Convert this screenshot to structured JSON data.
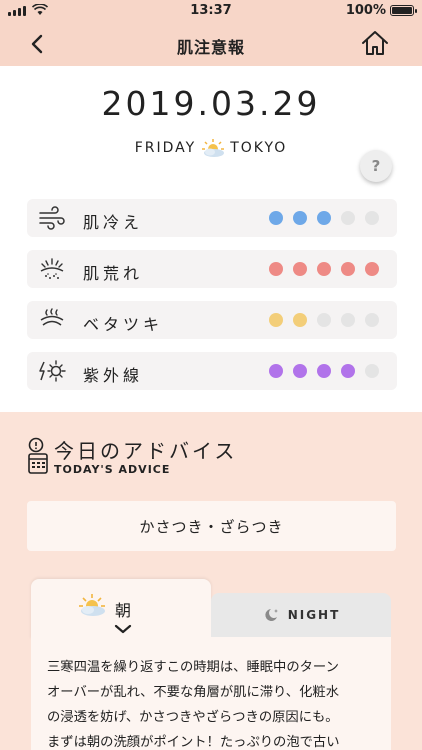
{
  "status_bar": {
    "time": "13:37",
    "battery": "100%",
    "battery_level": 1.0
  },
  "nav": {
    "title": "肌注意報",
    "back_icon": "chevron-left-icon",
    "home_icon": "home-icon"
  },
  "header": {
    "date": "2019.03.29",
    "day": "FRIDAY",
    "city": "TOKYO",
    "weather_icon": "sun-cloud-icon",
    "help_label": "?"
  },
  "metrics": [
    {
      "label": "肌冷え",
      "icon": "wind-icon",
      "level": 3,
      "max": 5,
      "color": "#6ea8e8"
    },
    {
      "label": "肌荒れ",
      "icon": "skin-burst-icon",
      "level": 5,
      "max": 5,
      "color": "#ee8a85"
    },
    {
      "label": "ベタツキ",
      "icon": "oily-icon",
      "level": 2,
      "max": 5,
      "color": "#f3ce79"
    },
    {
      "label": "紫外線",
      "icon": "uv-sun-icon",
      "level": 4,
      "max": 5,
      "color": "#b173ea"
    }
  ],
  "advice": {
    "title": "今日のアドバイス",
    "subtitle": "TODAY'S ADVICE",
    "icon": "calendar-alert-icon",
    "summary": "かさつき・ざらつき",
    "tabs": {
      "morning": "朝",
      "night": "NIGHT"
    },
    "lines": [
      "三寒四温を繰り返すこの時期は、睡眠中のターン",
      "オーバーが乱れ、不要な角層が肌に滞り、化粧水",
      "の浸透を妨げ、かさつきやざらつきの原因にも。",
      "まずは朝の洗顔がポイント！たっぷりの泡で古い"
    ]
  }
}
